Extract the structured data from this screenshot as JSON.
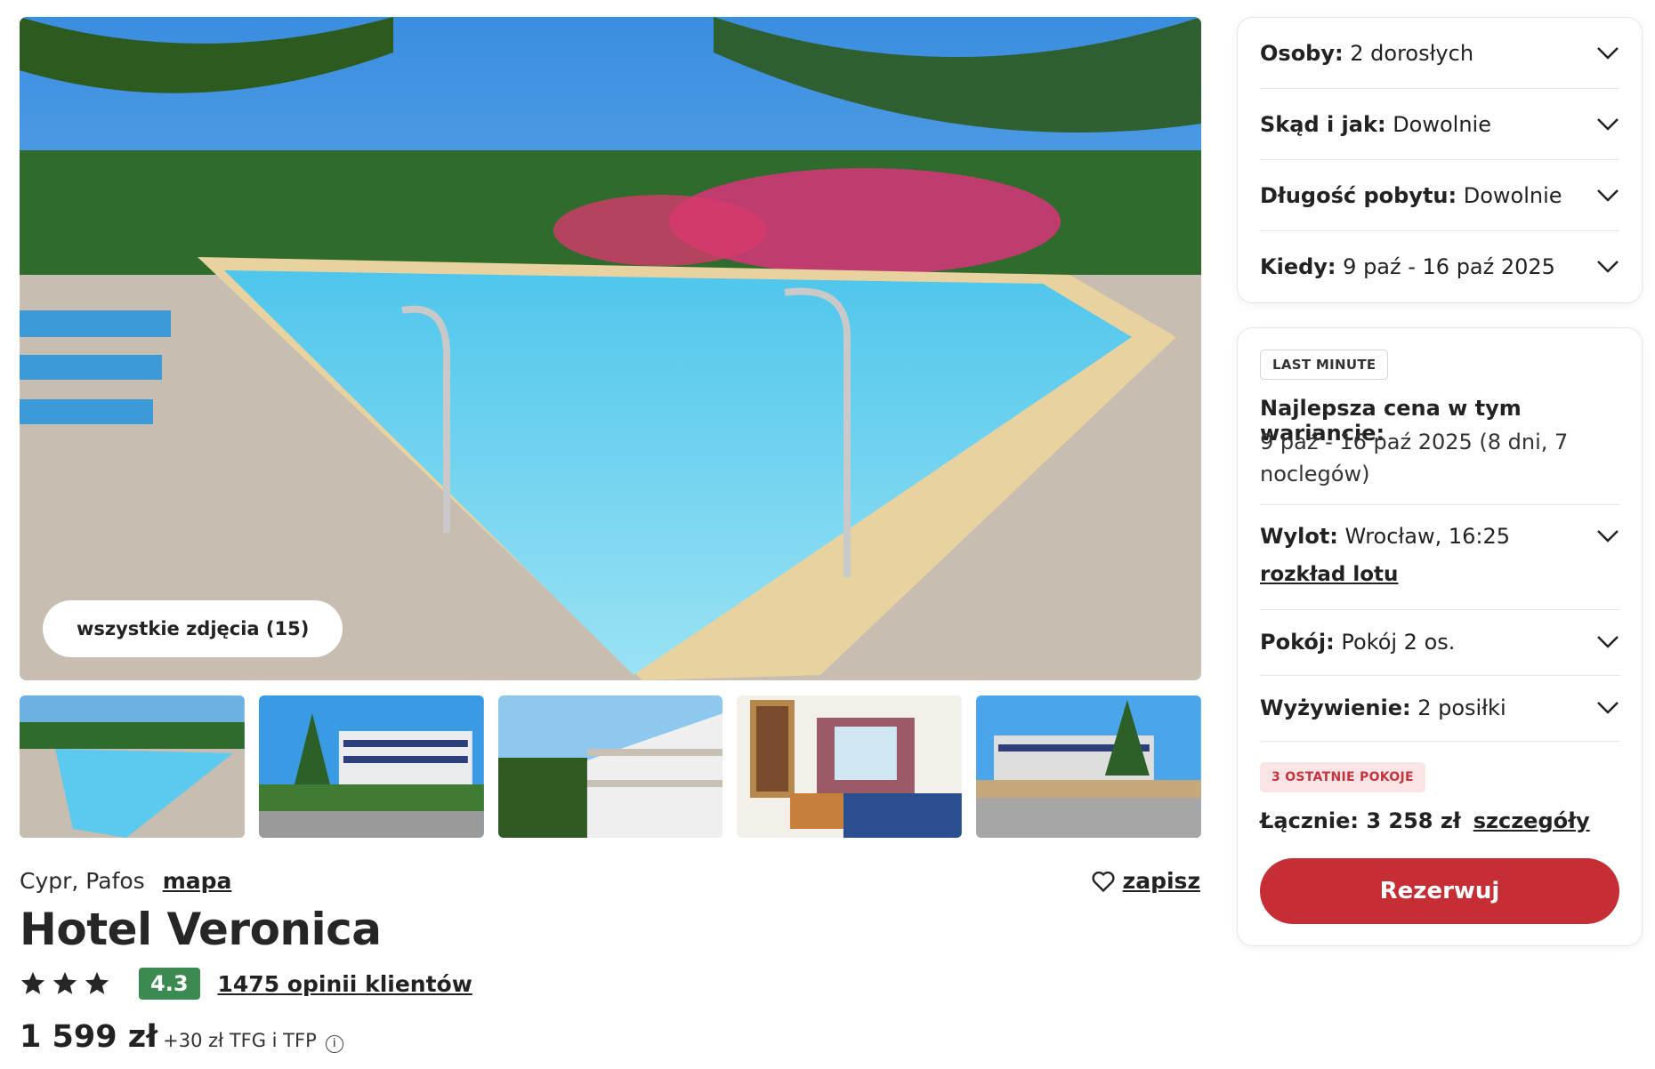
{
  "gallery": {
    "all_photos_label": "wszystkie zdjęcia (15)",
    "thumbnail_count": 5
  },
  "hotel": {
    "location": "Cypr, Pafos",
    "map_label": "mapa",
    "save_label": "zapisz",
    "name": "Hotel Veronica",
    "stars": 3,
    "rating": "4.3",
    "reviews_label": "1475 opinii klientów",
    "price_main": "1 599 zł",
    "price_extra": "+30 zł TFG i TFP",
    "info_icon": "i"
  },
  "filters": {
    "people": {
      "label": "Osoby:",
      "value": "2 dorosłych"
    },
    "from": {
      "label": "Skąd i jak:",
      "value": "Dowolnie"
    },
    "length": {
      "label": "Długość pobytu:",
      "value": "Dowolnie"
    },
    "when": {
      "label": "Kiedy:",
      "value": "9 paź - 16 paź 2025"
    }
  },
  "offer": {
    "badge": "LAST MINUTE",
    "best_title": "Najlepsza cena w tym wariancie:",
    "best_dates": "9 paź - 16 paź 2025 (8 dni, 7 noclegów)",
    "flight": {
      "label": "Wylot:",
      "value": "Wrocław, 16:25",
      "schedule_link": "rozkład lotu"
    },
    "room": {
      "label": "Pokój:",
      "value": "Pokój 2 os."
    },
    "board": {
      "label": "Wyżywienie:",
      "value": "2 posiłki"
    },
    "last_rooms_badge": "3 OSTATNIE POKOJE",
    "total_label": "Łącznie: 3 258 zł",
    "details_link": "szczegóły",
    "reserve_button": "Rezerwuj"
  },
  "colors": {
    "accent_red": "#c62e35",
    "rating_green": "#3a8a52",
    "badge_pink_bg": "#fbe4e6",
    "badge_pink_text": "#c33640"
  }
}
